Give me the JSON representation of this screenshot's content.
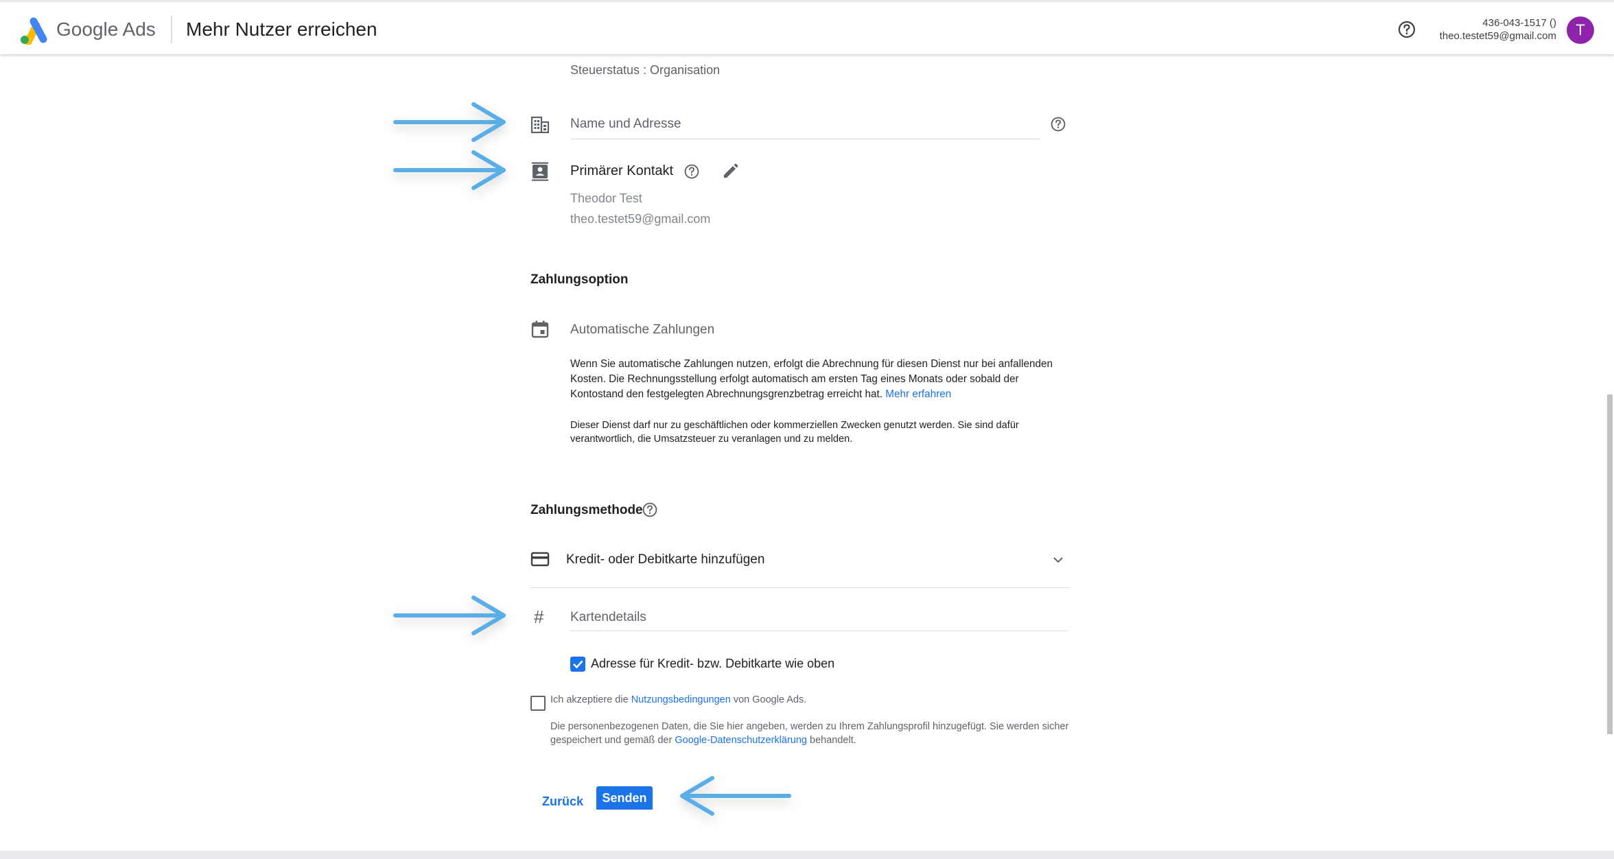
{
  "header": {
    "brand": "Google Ads",
    "title": "Mehr Nutzer erreichen",
    "account_id": "436-043-1517 ()",
    "account_email": "theo.testet59@gmail.com",
    "avatar_letter": "T"
  },
  "profile": {
    "tax_status": "Steuerstatus : Organisation",
    "name_address_placeholder": "Name und Adresse",
    "primary_contact_label": "Primärer Kontakt",
    "contact_name": "Theodor Test",
    "contact_email": "theo.testet59@gmail.com"
  },
  "payment_option": {
    "title": "Zahlungsoption",
    "option": "Automatische Zahlungen",
    "desc": "Wenn Sie automatische Zahlungen nutzen, erfolgt die Abrechnung für diesen Dienst nur bei anfallenden Kosten. Die Rechnungsstellung erfolgt automatisch am ersten Tag eines Monats oder sobald der Kontostand den festgelegten Abrechnungsgrenzbetrag erreicht hat.",
    "learn_more": "Mehr erfahren",
    "notice": "Dieser Dienst darf nur zu geschäftlichen oder kommerziellen Zwecken genutzt werden. Sie sind dafür verantwortlich, die Umsatzsteuer zu veranlagen und zu melden."
  },
  "payment_method": {
    "title": "Zahlungsmethode",
    "selected": "Kredit- oder Debitkarte hinzufügen",
    "card_details_placeholder": "Kartendetails",
    "same_address_label": "Adresse für Kredit- bzw. Debitkarte wie oben",
    "same_address_checked": true
  },
  "terms": {
    "prefix": "Ich akzeptiere die",
    "link": "Nutzungsbedingungen",
    "suffix": "von Google Ads.",
    "accepted": false,
    "privacy_prefix": "Die personenbezogenen Daten, die Sie hier angeben, werden zu Ihrem Zahlungsprofil hinzugefügt. Sie werden sicher gespeichert und gemäß der",
    "privacy_link": "Google-Datenschutzerklärung",
    "privacy_suffix": "behandelt."
  },
  "actions": {
    "back": "Zurück",
    "send": "Senden"
  },
  "colors": {
    "accent": "#1a73e8",
    "annotation_arrow": "#5aaee8",
    "avatar": "#8e24aa"
  }
}
